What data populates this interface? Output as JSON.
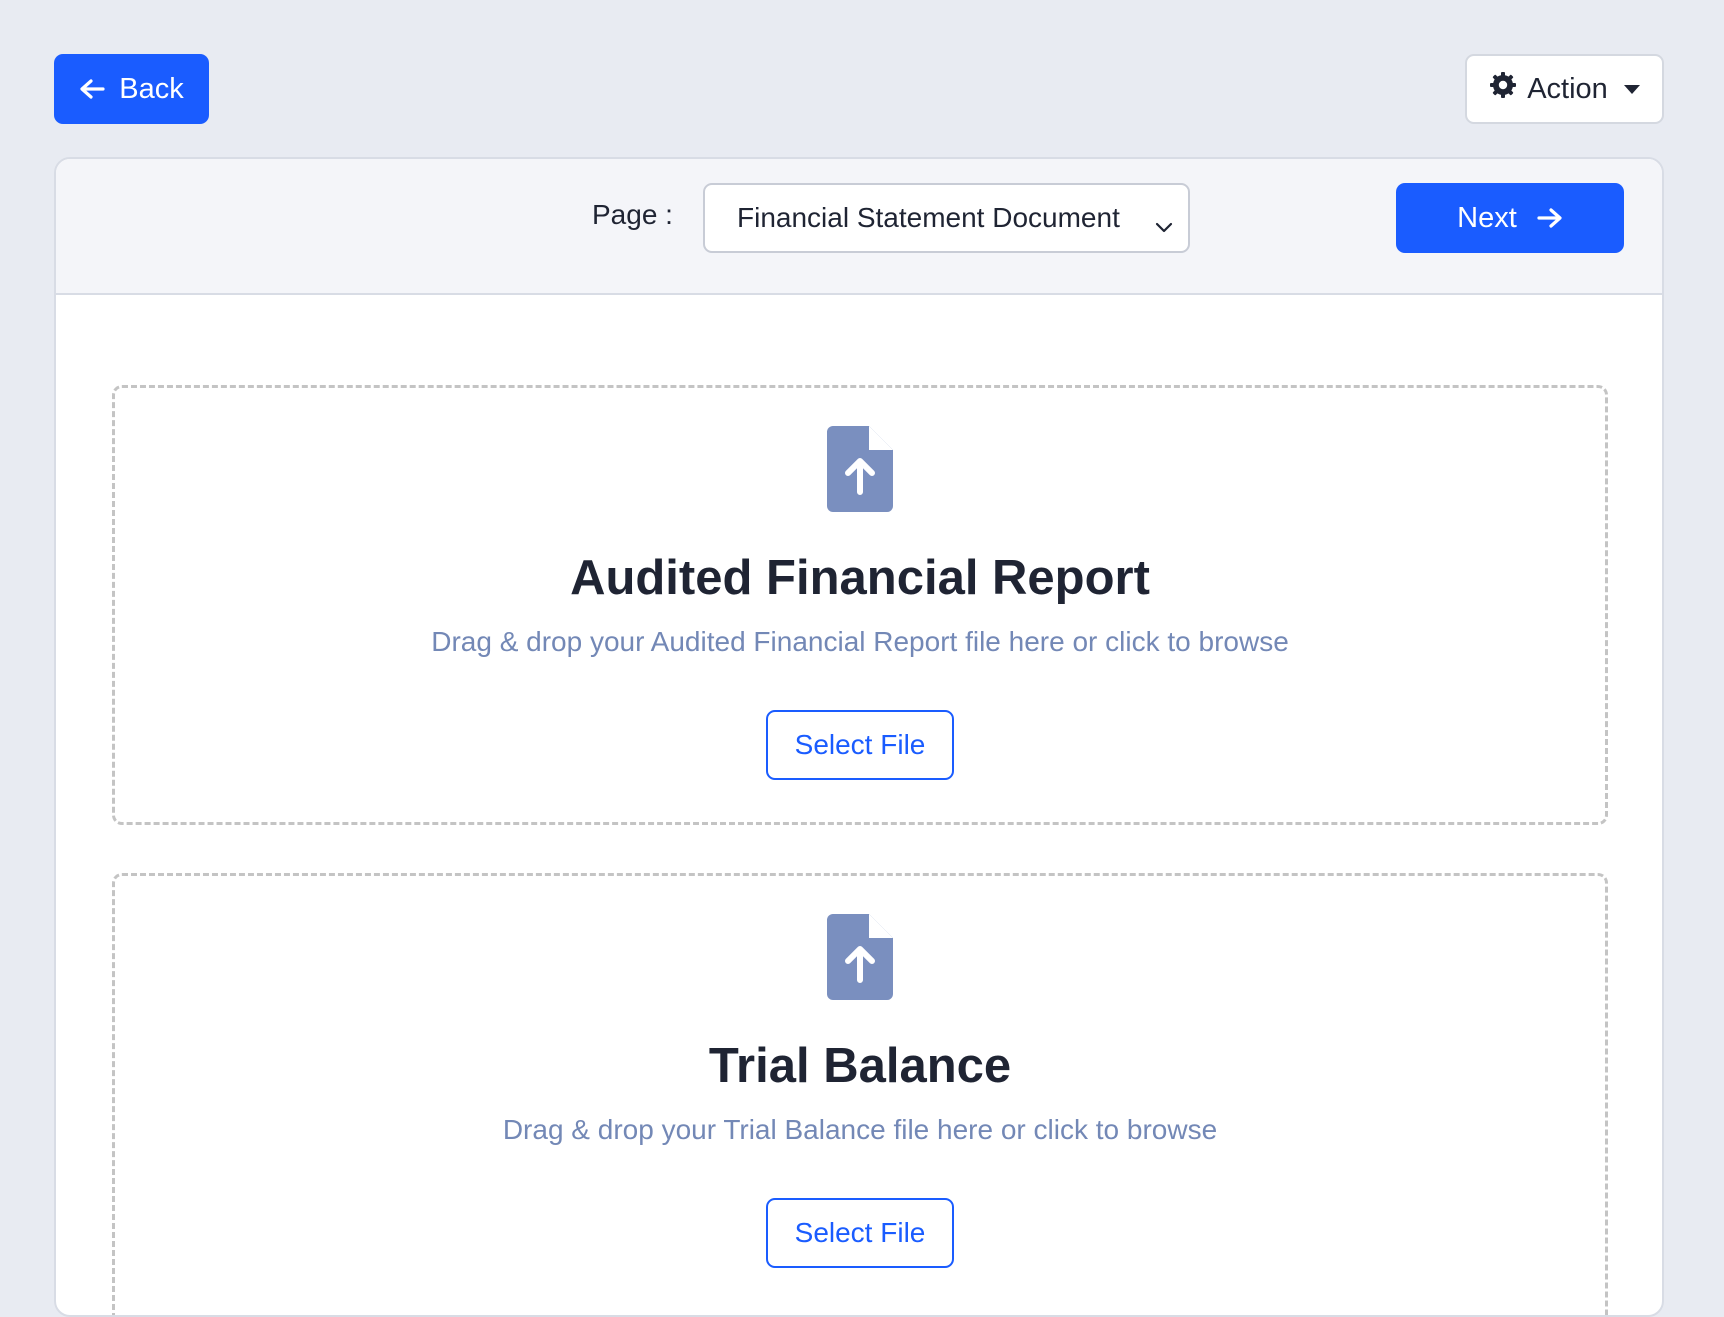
{
  "toolbar": {
    "back_label": "Back",
    "action_label": "Action"
  },
  "header": {
    "page_label": "Page :",
    "page_select_value": "Financial Statement Document",
    "next_label": "Next"
  },
  "uploads": [
    {
      "title": "Audited Financial Report",
      "hint": "Drag & drop your Audited Financial Report file here or click to browse",
      "button_label": "Select File"
    },
    {
      "title": "Trial Balance",
      "hint": "Drag & drop your Trial Balance file here or click to browse",
      "button_label": "Select File"
    }
  ],
  "colors": {
    "primary": "#1a5cff",
    "background": "#e8ebf2",
    "icon": "#7a8fbf",
    "hint_text": "#7388b6",
    "title_text": "#1f2433"
  },
  "icons": {
    "back": "arrow-left-icon",
    "action": "gear-icon",
    "action_caret": "caret-down-icon",
    "select_chevron": "chevron-down-icon",
    "next": "arrow-right-icon",
    "upload": "file-upload-icon"
  }
}
